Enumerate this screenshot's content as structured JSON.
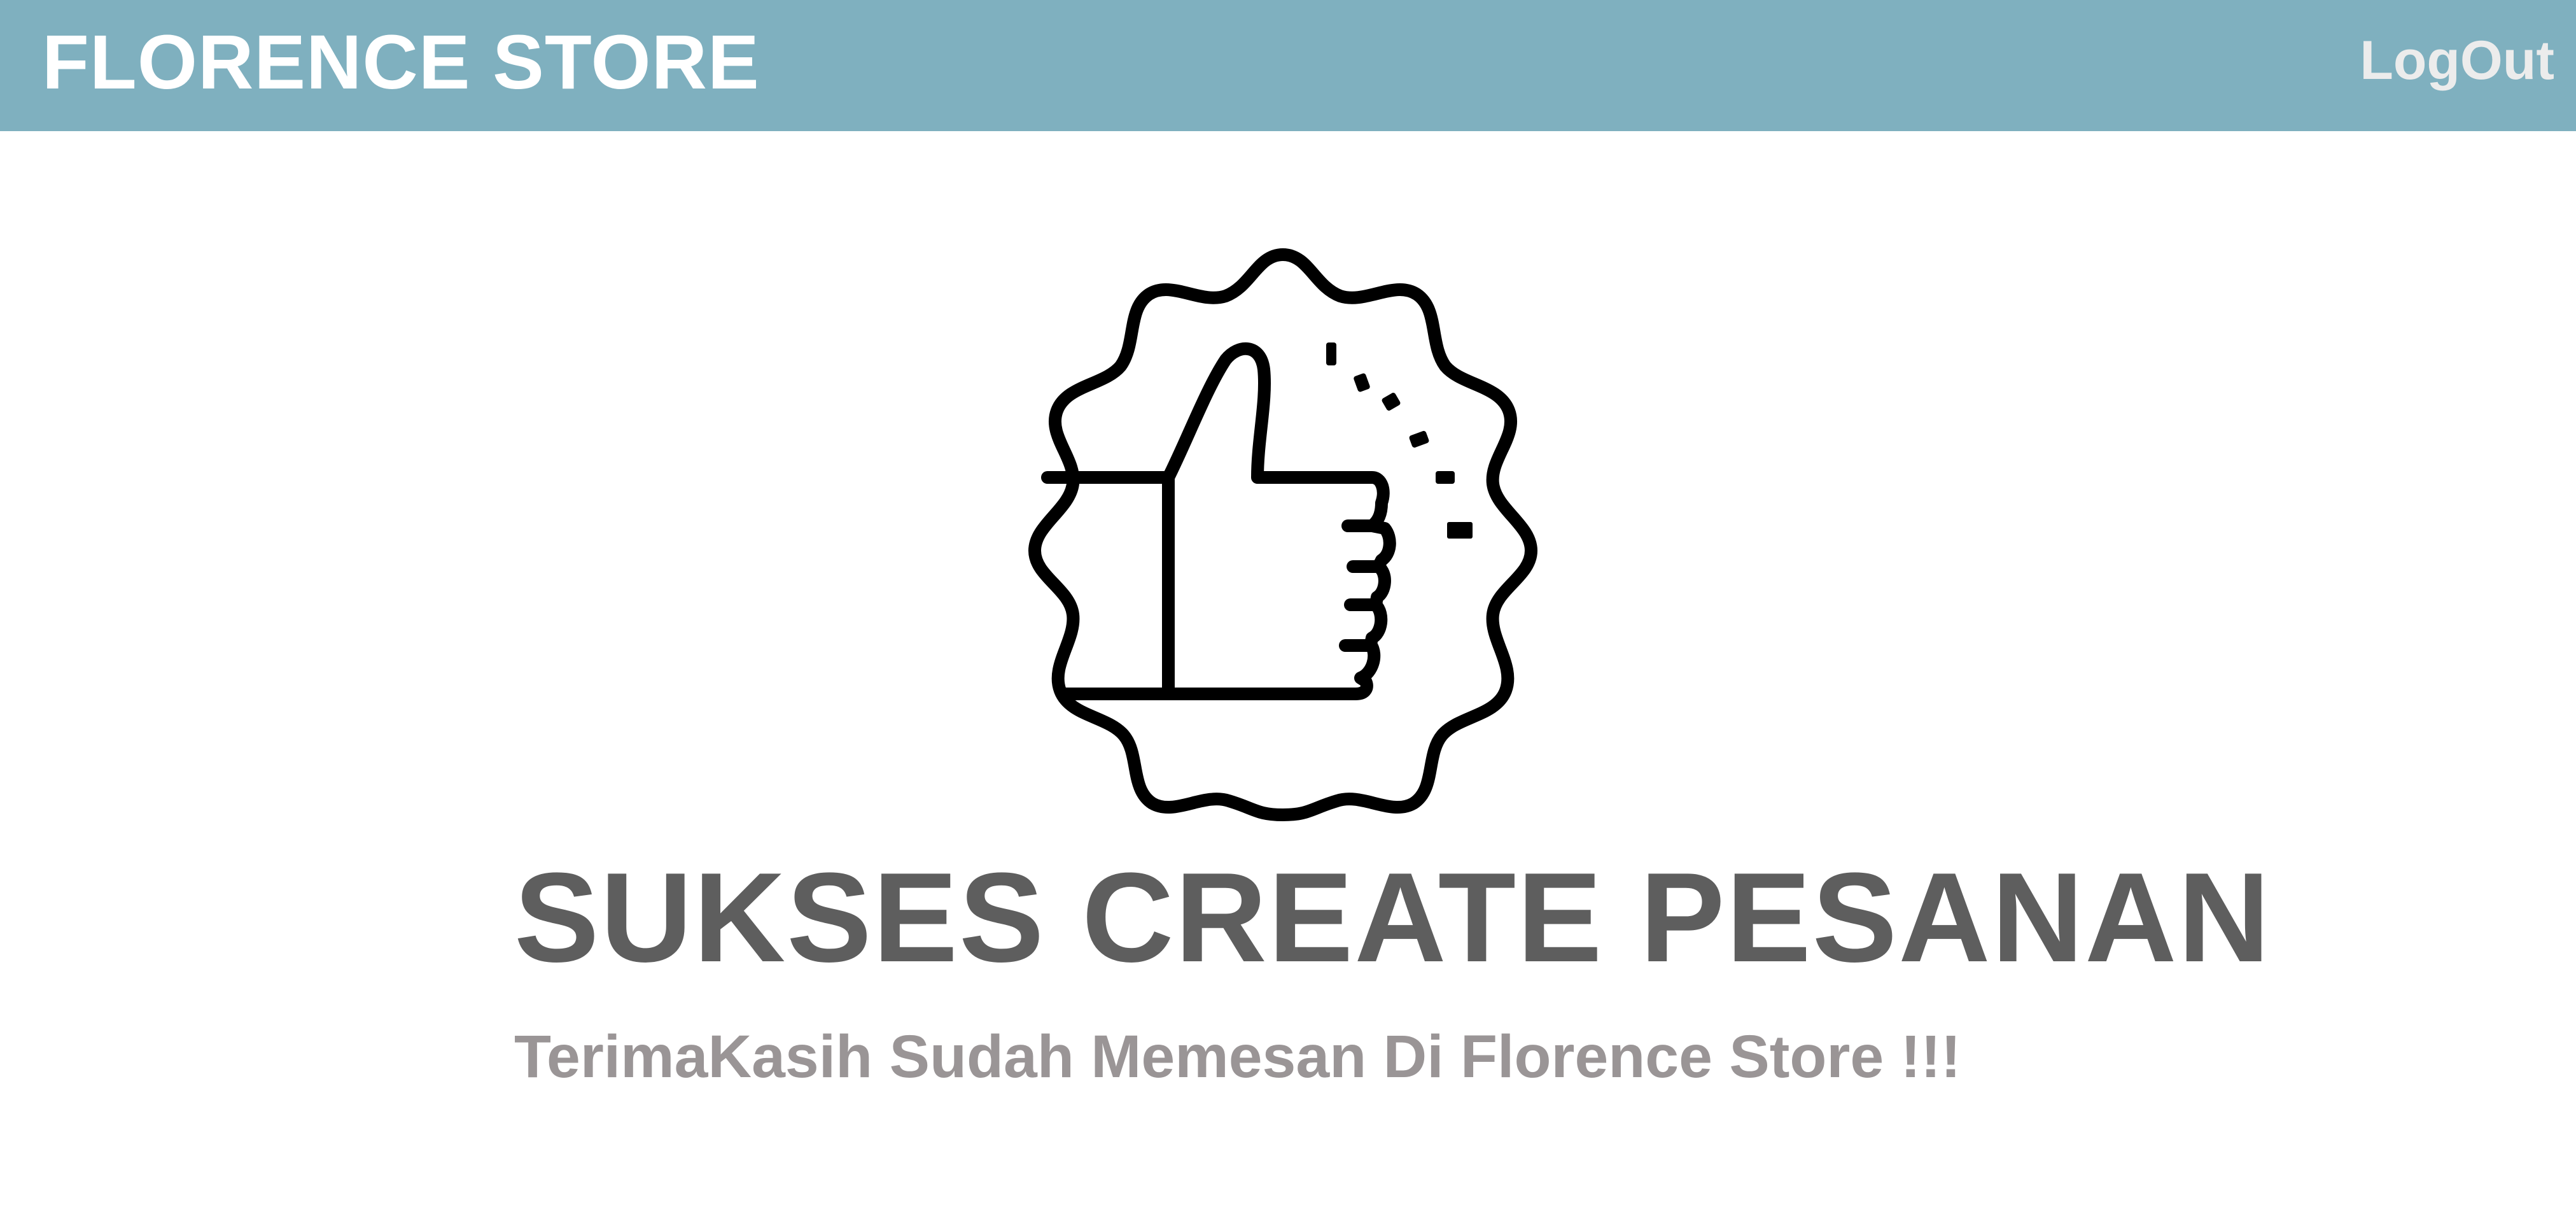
{
  "navbar": {
    "brand": "FLORENCE STORE",
    "logout_label": "LogOut"
  },
  "main": {
    "icon": "thumbs-up-badge-icon",
    "title": "SUKSES CREATE PESANAN",
    "subtitle": "TerimaKasih Sudah Memesan Di Florence Store !!!"
  },
  "colors": {
    "navbar_bg": "#7fb0bf",
    "brand_text": "#ffffff",
    "title_text": "#5e5e5e",
    "subtitle_text": "#9a9596"
  }
}
